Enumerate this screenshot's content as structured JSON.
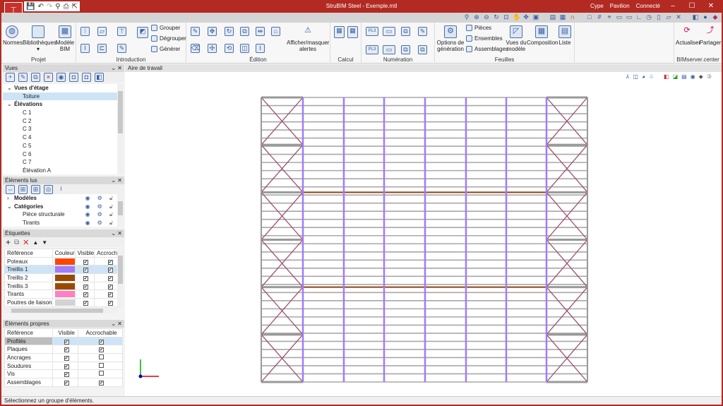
{
  "window": {
    "title": "StruBIM Steel - Exemple.mtl",
    "status_items": [
      "Cype",
      "Pavilion",
      "Connecté"
    ],
    "minimize": "–",
    "maximize": "☐",
    "close": "✕"
  },
  "ribbon": {
    "groups": [
      {
        "label": "Projet",
        "buttons": [
          "Normes",
          "Bibliothèques",
          "Modèle BIM"
        ]
      },
      {
        "label": "Introduction",
        "small": [
          "Grouper",
          "Dégrouper",
          "Générer"
        ]
      },
      {
        "label": "Édition",
        "buttons": [
          "Afficher/masquer alertes"
        ]
      },
      {
        "label": "Calcul"
      },
      {
        "label": "Numération"
      },
      {
        "label": "Feuilles",
        "buttons": [
          "Options de génération",
          "Vues du modèle",
          "Composition",
          "Liste"
        ],
        "small": [
          "Pièces",
          "Ensembles",
          "Assemblages"
        ]
      },
      {
        "label": "BIMserver.center",
        "buttons": [
          "Actualiser",
          "Partager"
        ]
      }
    ]
  },
  "vues": {
    "title": "Vues",
    "items": [
      {
        "label": "Vues d'étage",
        "level": 0,
        "expanded": true
      },
      {
        "label": "Toiture",
        "level": 1,
        "selected": true
      },
      {
        "label": "Élévations",
        "level": 0,
        "expanded": true
      },
      {
        "label": "C 1",
        "level": 1
      },
      {
        "label": "C 2",
        "level": 1
      },
      {
        "label": "C 3",
        "level": 1
      },
      {
        "label": "C 4",
        "level": 1
      },
      {
        "label": "C 5",
        "level": 1
      },
      {
        "label": "C 6",
        "level": 1
      },
      {
        "label": "C 7",
        "level": 1
      },
      {
        "label": "Élévation A",
        "level": 1
      }
    ]
  },
  "elements_lus": {
    "title": "Éléments lus",
    "items": [
      {
        "label": "Modèles",
        "level": 0,
        "expanded": false
      },
      {
        "label": "Catégories",
        "level": 0,
        "expanded": true
      },
      {
        "label": "Pièce structurale",
        "level": 1
      },
      {
        "label": "Tirants",
        "level": 1
      }
    ]
  },
  "etiquettes": {
    "title": "Étiquettes",
    "columns": [
      "Référence",
      "Couleur",
      "Visible",
      "Accrochab"
    ],
    "rows": [
      {
        "ref": "Poteaux",
        "color": "#ff4500",
        "visible": true,
        "snap": true
      },
      {
        "ref": "Treillis 1",
        "color": "#a07cf8",
        "visible": true,
        "snap": true,
        "selected": true
      },
      {
        "ref": "Treillis 2",
        "color": "#9a4a00",
        "visible": true,
        "snap": true
      },
      {
        "ref": "Treillis 3",
        "color": "#9a4a00",
        "visible": true,
        "snap": true
      },
      {
        "ref": "Tirants",
        "color": "#ff80c0",
        "visible": true,
        "snap": true
      },
      {
        "ref": "Poutres de liaison",
        "color": "#d3d3d3",
        "visible": true,
        "snap": true
      }
    ]
  },
  "elements_propres": {
    "title": "Éléments propres",
    "columns": [
      "Référence",
      "Visible",
      "Accrochable"
    ],
    "rows": [
      {
        "ref": "Profilés",
        "visible": true,
        "snap": true
      },
      {
        "ref": "Plaques",
        "visible": true,
        "snap": true
      },
      {
        "ref": "Ancrages",
        "visible": true,
        "snap": false
      },
      {
        "ref": "Soudures",
        "visible": true,
        "snap": false
      },
      {
        "ref": "Vis",
        "visible": true,
        "snap": false
      },
      {
        "ref": "Assemblages",
        "visible": true,
        "snap": true
      }
    ]
  },
  "workspace": {
    "title": "Aire de travail"
  },
  "status": "Sélectionnez un groupe d'éléments.",
  "colors": {
    "title_bar": "#b22a22",
    "truss": "#a07cf8",
    "bracing": "#9c5070",
    "beam": "#8b4513",
    "purlin": "#a8a8a8"
  }
}
